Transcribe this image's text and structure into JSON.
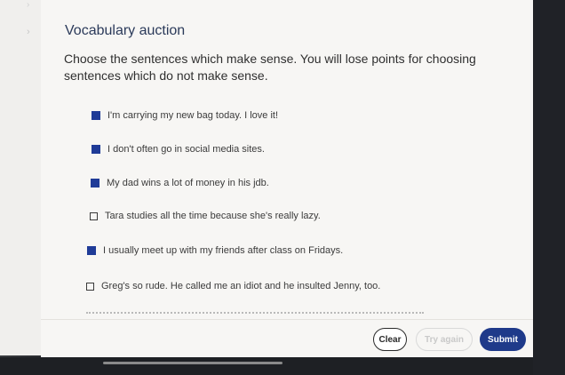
{
  "app": {
    "title": "Vocabulary auction",
    "instructions": "Choose the sentences which make sense. You will lose points for choosing sentences which do not make sense.",
    "nav_chevron": "›"
  },
  "options": [
    {
      "text": "I'm carrying my new bag today. I love it!",
      "checked": true
    },
    {
      "text": "I don't often go in social media sites.",
      "checked": true
    },
    {
      "text": "My dad wins a lot of money in his jdb.",
      "checked": true
    },
    {
      "text": "Tara studies all the time because she's really  lazy.",
      "checked": false
    },
    {
      "text": "I usually meet up with my friends after class on Fridays.",
      "checked": true
    },
    {
      "text": "Greg's so rude. He called me an idiot and he insulted Jenny, too.",
      "checked": false
    }
  ],
  "footer": {
    "clear_label": "Clear",
    "try_again_label": "Try again",
    "submit_label": "Submit"
  },
  "colors": {
    "accent": "#1f3a8a",
    "checked_box": "#1f3b97",
    "title": "#2b3a5a"
  }
}
